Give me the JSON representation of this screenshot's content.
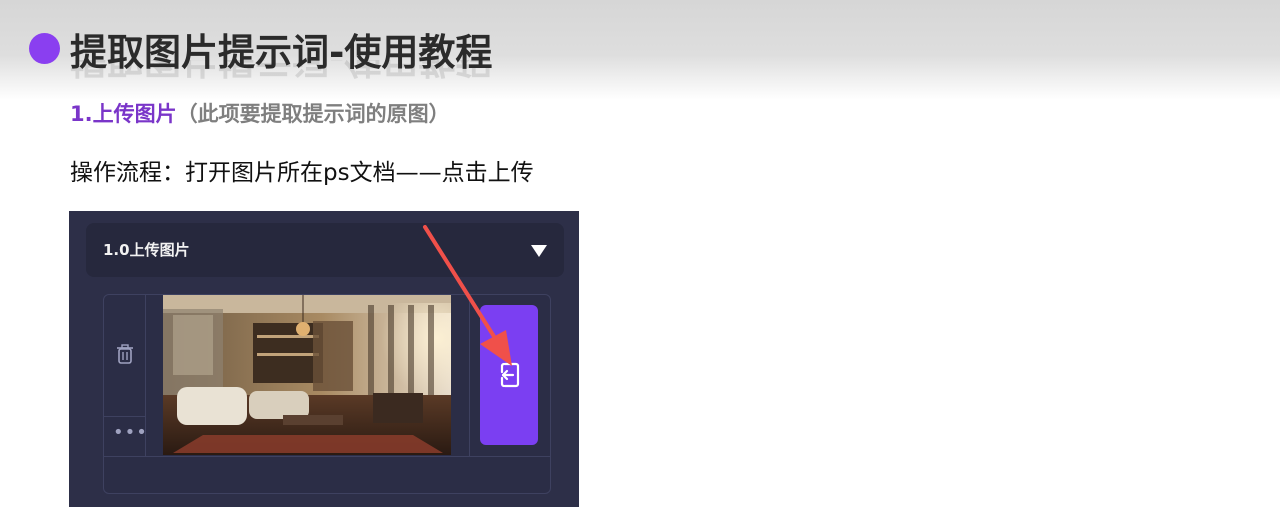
{
  "title": "提取图片提示词-使用教程",
  "section": {
    "heading": "1.上传图片",
    "note": "（此项要提取提示词的原图）"
  },
  "instructions": "操作流程：打开图片所在ps文档——点击上传",
  "panel": {
    "header_label": "1.0上传图片",
    "more_label": "•••"
  },
  "colors": {
    "accent": "#7b3ff2",
    "bullet": "#8a3ff0",
    "heading": "#7a35c9",
    "note": "#7f7f7f",
    "panel_bg": "#2d2f48",
    "arrow": "#f0504a"
  },
  "icons": {
    "bullet": "filled-circle",
    "chevron": "triangle-down-icon",
    "trash": "trash-icon",
    "more": "ellipsis-icon",
    "upload": "import-icon",
    "annotation": "red-arrow"
  }
}
